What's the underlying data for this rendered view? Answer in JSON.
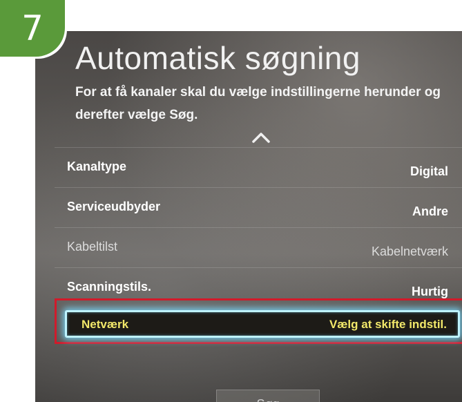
{
  "step_badge": "7",
  "header": {
    "title": "Automatisk søgning",
    "subtitle": "For at få kanaler skal du vælge indstillingerne herunder og derefter vælge Søg."
  },
  "scroll_up_icon": "chevron-up-icon",
  "settings": [
    {
      "label": "Kanaltype",
      "value": "Digital"
    },
    {
      "label": "Serviceudbyder",
      "value": "Andre"
    },
    {
      "label": "Kabeltilst",
      "value": "Kabelnetværk"
    },
    {
      "label": "Scanningstils.",
      "value": "Hurtig"
    }
  ],
  "selected_item": {
    "label": "Netværk",
    "value": "Vælg at skifte indstil."
  },
  "search_button": "Søg",
  "colors": {
    "badge": "#5a9a3a",
    "highlight_text": "#f2e86a",
    "annotation_box": "#d21a2a",
    "focus_glow": "#bff3ff"
  }
}
